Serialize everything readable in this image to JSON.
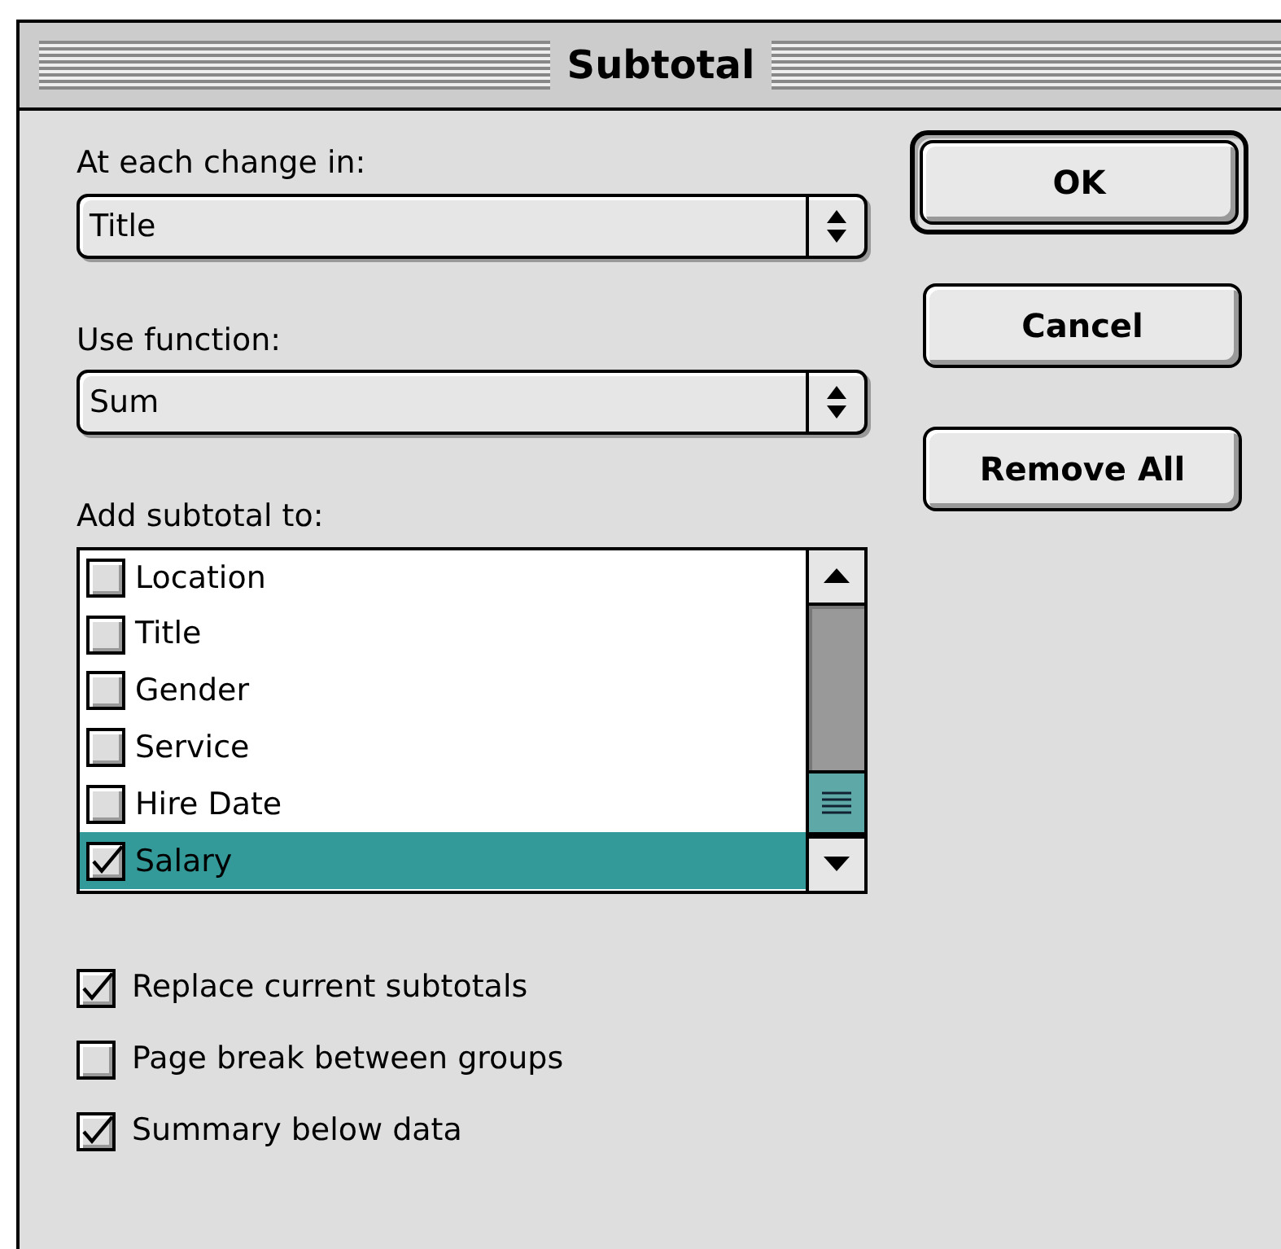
{
  "window": {
    "title": "Subtotal"
  },
  "popups": [
    {
      "label": "At each change in:",
      "value": "Title"
    },
    {
      "label": "Use function:",
      "value": "Sum"
    }
  ],
  "list": {
    "label": "Add subtotal to:",
    "items": [
      {
        "label": "Location",
        "checked": false,
        "selected": false
      },
      {
        "label": "Title",
        "checked": false,
        "selected": false
      },
      {
        "label": "Gender",
        "checked": false,
        "selected": false
      },
      {
        "label": "Service",
        "checked": false,
        "selected": false
      },
      {
        "label": "Hire Date",
        "checked": false,
        "selected": false
      },
      {
        "label": "Salary",
        "checked": true,
        "selected": true
      }
    ]
  },
  "options": [
    {
      "label": "Replace current subtotals",
      "checked": true
    },
    {
      "label": "Page break between groups",
      "checked": false
    },
    {
      "label": "Summary below data",
      "checked": true
    }
  ],
  "buttons": [
    {
      "label": "OK",
      "default": true
    },
    {
      "label": "Cancel",
      "default": false
    },
    {
      "label": "Remove All",
      "default": false
    }
  ]
}
